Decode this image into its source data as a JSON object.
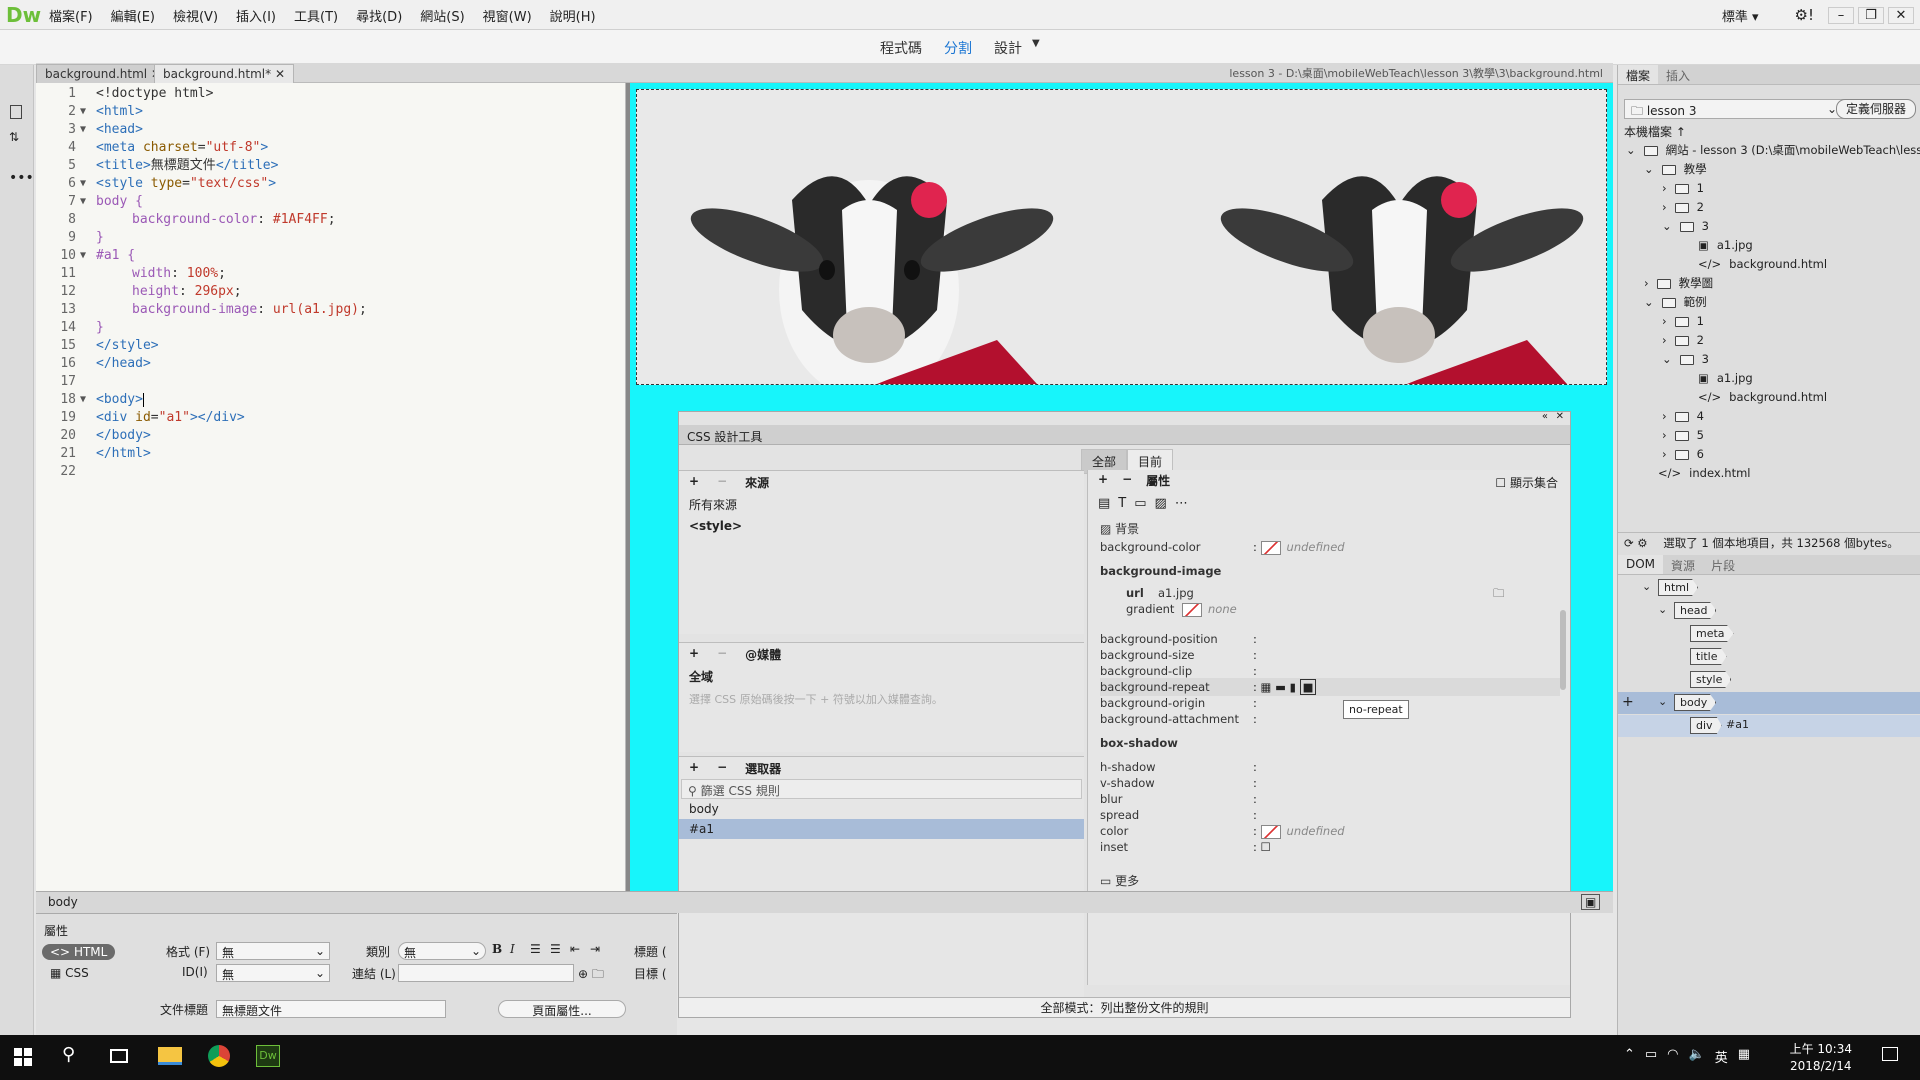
{
  "app": {
    "logo": "Dw"
  },
  "menu": [
    "檔案(F)",
    "編輯(E)",
    "檢視(V)",
    "插入(I)",
    "工具(T)",
    "尋找(D)",
    "網站(S)",
    "視窗(W)",
    "說明(H)"
  ],
  "workspace": {
    "label": "標準"
  },
  "view_buttons": {
    "code": "程式碼",
    "split": "分割",
    "design": "設計"
  },
  "tabs": [
    {
      "label": "background.html"
    },
    {
      "label": "background.html*"
    }
  ],
  "file_path": "lesson 3 - D:\\桌面\\mobileWebTeach\\lesson 3\\教學\\3\\background.html",
  "code_lines": [
    {
      "n": "1",
      "fold": ""
    },
    {
      "n": "2",
      "fold": "▼"
    },
    {
      "n": "3",
      "fold": "▼"
    },
    {
      "n": "4",
      "fold": ""
    },
    {
      "n": "5",
      "fold": ""
    },
    {
      "n": "6",
      "fold": "▼"
    },
    {
      "n": "7",
      "fold": "▼"
    },
    {
      "n": "8",
      "fold": ""
    },
    {
      "n": "9",
      "fold": ""
    },
    {
      "n": "10",
      "fold": "▼"
    },
    {
      "n": "11",
      "fold": ""
    },
    {
      "n": "12",
      "fold": ""
    },
    {
      "n": "13",
      "fold": ""
    },
    {
      "n": "14",
      "fold": ""
    },
    {
      "n": "15",
      "fold": ""
    },
    {
      "n": "16",
      "fold": ""
    },
    {
      "n": "17",
      "fold": ""
    },
    {
      "n": "18",
      "fold": "▼"
    },
    {
      "n": "19",
      "fold": ""
    },
    {
      "n": "20",
      "fold": ""
    },
    {
      "n": "21",
      "fold": ""
    },
    {
      "n": "22",
      "fold": ""
    }
  ],
  "code": {
    "l1": "<!doctype html>",
    "l2": "<html>",
    "l3": "<head>",
    "l4a": "<meta ",
    "l4b": "charset",
    "l4c": "=",
    "l4d": "\"utf-8\"",
    "l4e": ">",
    "l5a": "<title>",
    "l5b": "無標題文件",
    "l5c": "</title>",
    "l6a": "<style ",
    "l6b": "type",
    "l6c": "=",
    "l6d": "\"text/css\"",
    "l6e": ">",
    "l7": "body {",
    "l8a": "background-color",
    "l8b": ": ",
    "l8c": "#1AF4FF",
    "l8d": ";",
    "l9": "}",
    "l10": "#a1 {",
    "l11a": "width",
    "l11b": ": ",
    "l11c": "100%",
    "l11d": ";",
    "l12a": "height",
    "l12b": ": ",
    "l12c": "296px",
    "l12d": ";",
    "l13a": "background-image",
    "l13b": ": ",
    "l13c": "url(a1.jpg)",
    "l13d": ";",
    "l14": "}",
    "l15": "</style>",
    "l16": "</head>",
    "l17": "",
    "l18": "<body>",
    "l19a": "<div ",
    "l19b": "id",
    "l19c": "=",
    "l19d": "\"a1\"",
    "l19e": "></div>",
    "l20": "</body>",
    "l21": "</html>",
    "l22": ""
  },
  "colors": {
    "design_bg": "#1AF4FF",
    "accent": "#1b76d3",
    "selected_row": "#a8bcd8"
  },
  "tag_selector": "body",
  "css_designer": {
    "title": "CSS 設計工具",
    "seg_all": "全部",
    "seg_current": "目前",
    "sources_label": "來源",
    "sources": [
      "所有來源",
      "<style>"
    ],
    "media_label": "@媒體",
    "media_global": "全域",
    "media_hint": "選擇 CSS 原始碼後按一下 + 符號以加入媒體查詢。",
    "selectors_label": "選取器",
    "selector_filter_placeholder": "篩選 CSS 規則",
    "selectors": [
      "body",
      "#a1"
    ],
    "properties_label": "屬性",
    "show_set": "顯示集合",
    "bg_section": "背景",
    "p_bgcolor": "background-color",
    "undefined": "undefined",
    "bg_image_head": "background-image",
    "url_label": "url",
    "url_value": "a1.jpg",
    "gradient_label": "gradient",
    "gradient_value": "none",
    "p_bgpos": "background-position",
    "p_bgsize": "background-size",
    "p_bgclip": "background-clip",
    "p_bgrepeat": "background-repeat",
    "p_bgorigin": "background-origin",
    "p_bgattach": "background-attachment",
    "tooltip": "no-repeat",
    "box_shadow_head": "box-shadow",
    "p_hshadow": "h-shadow",
    "p_vshadow": "v-shadow",
    "p_blur": "blur",
    "p_spread": "spread",
    "p_color": "color",
    "p_inset": "inset",
    "more": "更多",
    "colon": ":",
    "footer": "全部模式：列出整份文件的規則"
  },
  "files_panel": {
    "tab_files": "檔案",
    "tab_insert": "插入",
    "site_select": "lesson 3",
    "define_server": "定義伺服器",
    "local_files": "本機檔案 ↑",
    "tree": [
      {
        "label": "網站 - lesson 3 (D:\\桌面\\mobileWebTeach\\less...",
        "arrow": "⌄",
        "kind": "folder"
      },
      {
        "label": "教學",
        "arrow": "⌄",
        "kind": "folder"
      },
      {
        "label": "1",
        "arrow": "›",
        "kind": "folder"
      },
      {
        "label": "2",
        "arrow": "›",
        "kind": "folder"
      },
      {
        "label": "3",
        "arrow": "⌄",
        "kind": "folder"
      },
      {
        "label": "a1.jpg",
        "arrow": "",
        "kind": "image"
      },
      {
        "label": "background.html",
        "arrow": "",
        "kind": "code"
      },
      {
        "label": "教學圖",
        "arrow": "›",
        "kind": "folder"
      },
      {
        "label": "範例",
        "arrow": "⌄",
        "kind": "folder"
      },
      {
        "label": "1",
        "arrow": "›",
        "kind": "folder"
      },
      {
        "label": "2",
        "arrow": "›",
        "kind": "folder"
      },
      {
        "label": "3",
        "arrow": "⌄",
        "kind": "folder"
      },
      {
        "label": "a1.jpg",
        "arrow": "",
        "kind": "image"
      },
      {
        "label": "background.html",
        "arrow": "",
        "kind": "code"
      },
      {
        "label": "4",
        "arrow": "›",
        "kind": "folder"
      },
      {
        "label": "5",
        "arrow": "›",
        "kind": "folder"
      },
      {
        "label": "6",
        "arrow": "›",
        "kind": "folder"
      },
      {
        "label": "index.html",
        "arrow": "",
        "kind": "code"
      }
    ],
    "status": "選取了 1 個本地項目，共 132568 個bytes。"
  },
  "dom_panel": {
    "tabs": [
      "DOM",
      "資源",
      "片段"
    ],
    "nodes": [
      {
        "label": "html",
        "arrow": "⌄"
      },
      {
        "label": "head",
        "arrow": "⌄"
      },
      {
        "label": "meta",
        "arrow": ""
      },
      {
        "label": "title",
        "arrow": ""
      },
      {
        "label": "style",
        "arrow": ""
      },
      {
        "label": "body",
        "arrow": "⌄"
      },
      {
        "label": "div",
        "arrow": "",
        "suffix": "#a1"
      }
    ]
  },
  "properties_panel": {
    "title": "屬性",
    "html_btn": "HTML",
    "css_btn": "CSS",
    "format_label": "格式 (F)",
    "format_value": "無",
    "id_label": "ID(I)",
    "id_value": "無",
    "class_label": "類別",
    "class_value": "無",
    "link_label": "連結 (L)",
    "link_value": "",
    "title_label": "標題 (",
    "target_label": "目標 (",
    "doc_title_label": "文件標題",
    "doc_title_value": "無標題文件",
    "page_props_btn": "頁面屬性..."
  },
  "taskbar": {
    "time": "上午 10:34",
    "date": "2018/2/14",
    "ime": "英"
  }
}
